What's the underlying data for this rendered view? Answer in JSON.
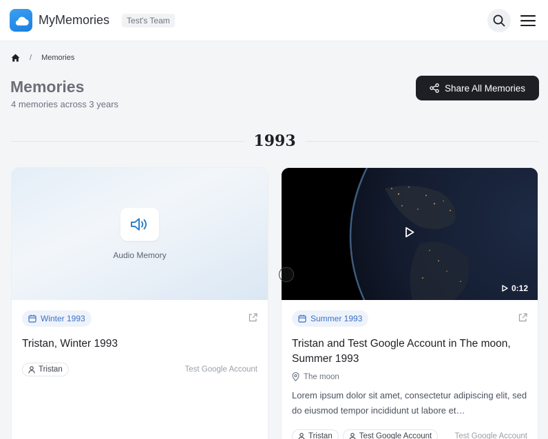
{
  "app": {
    "brand": "MyMemories",
    "team": "Test's Team"
  },
  "breadcrumb": {
    "separator": "/",
    "current": "Memories"
  },
  "page": {
    "title": "Memories",
    "subtitle": "4 memories across 3 years",
    "share_label": "Share All Memories"
  },
  "year": "1993",
  "cards": [
    {
      "media_type": "audio",
      "media_label": "Audio Memory",
      "date": "Winter 1993",
      "title": "Tristan, Winter 1993",
      "tags": [
        "Tristan"
      ],
      "owner": "Test Google Account"
    },
    {
      "media_type": "video",
      "duration": "0:12",
      "date": "Summer 1993",
      "title": "Tristan and Test Google Account in The moon, Summer 1993",
      "location": "The moon",
      "description": "Lorem ipsum dolor sit amet, consectetur adipiscing elit, sed do eiusmod tempor incididunt ut labore et…",
      "tags": [
        "Tristan",
        "Test Google Account"
      ],
      "owner": "Test Google Account"
    }
  ],
  "colors": {
    "accent": "#3b6fc4",
    "brand": "#1b7fe0",
    "primary_button": "#1d1f24"
  },
  "icons": {
    "logo": "cloud-icon",
    "search": "search-icon",
    "menu": "hamburger-menu-icon",
    "home": "home-icon",
    "share": "share-icon",
    "audio": "speaker-icon",
    "date": "calendar-icon",
    "link": "external-link-icon",
    "location": "map-pin-icon",
    "person": "user-icon",
    "play": "play-icon"
  }
}
